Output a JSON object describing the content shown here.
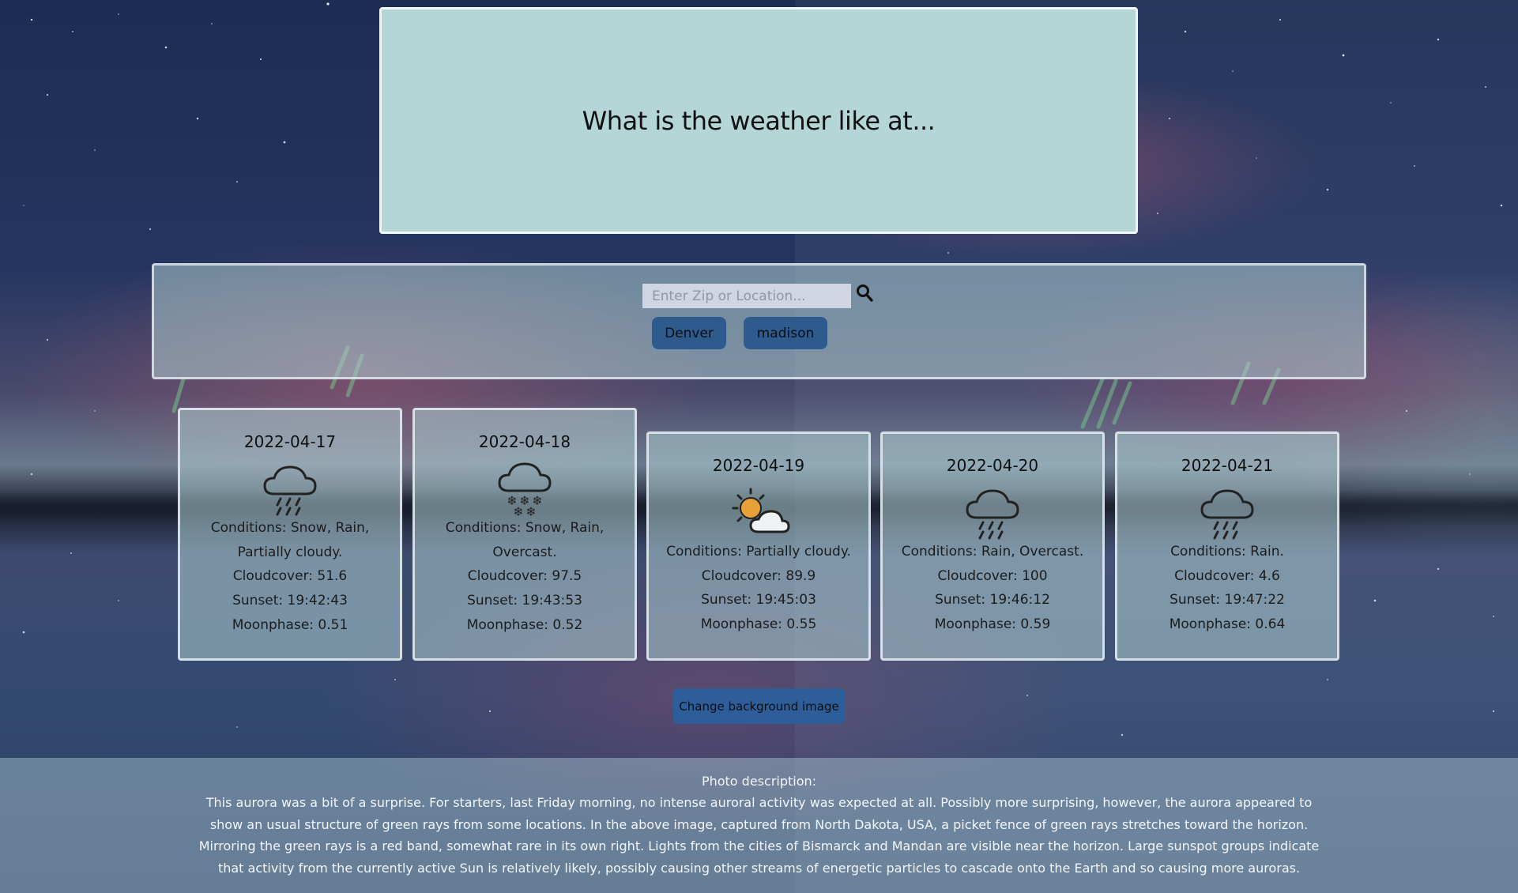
{
  "header": {
    "title": "What is the weather like at..."
  },
  "search": {
    "placeholder": "Enter Zip or Location...",
    "icon": "search-icon",
    "recent": [
      "Denver",
      "madison"
    ]
  },
  "forecast": [
    {
      "date": "2022-04-17",
      "icon": "rain-snow-icon",
      "conditions": "Conditions: Snow, Rain, Partially cloudy.",
      "cloudcover": "Cloudcover: 51.6",
      "sunset": "Sunset: 19:42:43",
      "moonphase": "Moonphase: 0.51"
    },
    {
      "date": "2022-04-18",
      "icon": "snow-icon",
      "conditions": "Conditions: Snow, Rain, Overcast.",
      "cloudcover": "Cloudcover: 97.5",
      "sunset": "Sunset: 19:43:53",
      "moonphase": "Moonphase: 0.52"
    },
    {
      "date": "2022-04-19",
      "icon": "partly-cloudy-day-icon",
      "conditions": "Conditions: Partially cloudy.",
      "cloudcover": "Cloudcover: 89.9",
      "sunset": "Sunset: 19:45:03",
      "moonphase": "Moonphase: 0.55"
    },
    {
      "date": "2022-04-20",
      "icon": "rain-icon",
      "conditions": "Conditions: Rain, Overcast.",
      "cloudcover": "Cloudcover: 100",
      "sunset": "Sunset: 19:46:12",
      "moonphase": "Moonphase: 0.59"
    },
    {
      "date": "2022-04-21",
      "icon": "rain-icon",
      "conditions": "Conditions: Rain.",
      "cloudcover": "Cloudcover: 4.6",
      "sunset": "Sunset: 19:47:22",
      "moonphase": "Moonphase: 0.64"
    }
  ],
  "actions": {
    "change_background_label": "Change background image"
  },
  "photo": {
    "label": "Photo description:",
    "description": "This aurora was a bit of a surprise. For starters, last Friday morning, no intense auroral activity was expected at all. Possibly more surprising, however, the aurora appeared to show an usual structure of green rays from some locations. In the above image, captured from North Dakota, USA, a picket fence of green rays stretches toward the horizon. Mirroring the green rays is a red band, somewhat rare in its own right. Lights from the cities of Bismarck and Mandan are visible near the horizon. Large sunspot groups indicate that activity from the currently active Sun is relatively likely, possibly causing other streams of energetic particles to cascade onto the Earth and so causing more auroras."
  },
  "colors": {
    "header_bg": "#b4d6d7",
    "button_bg": "#2e5b8e",
    "sun": "#e8a03a"
  }
}
